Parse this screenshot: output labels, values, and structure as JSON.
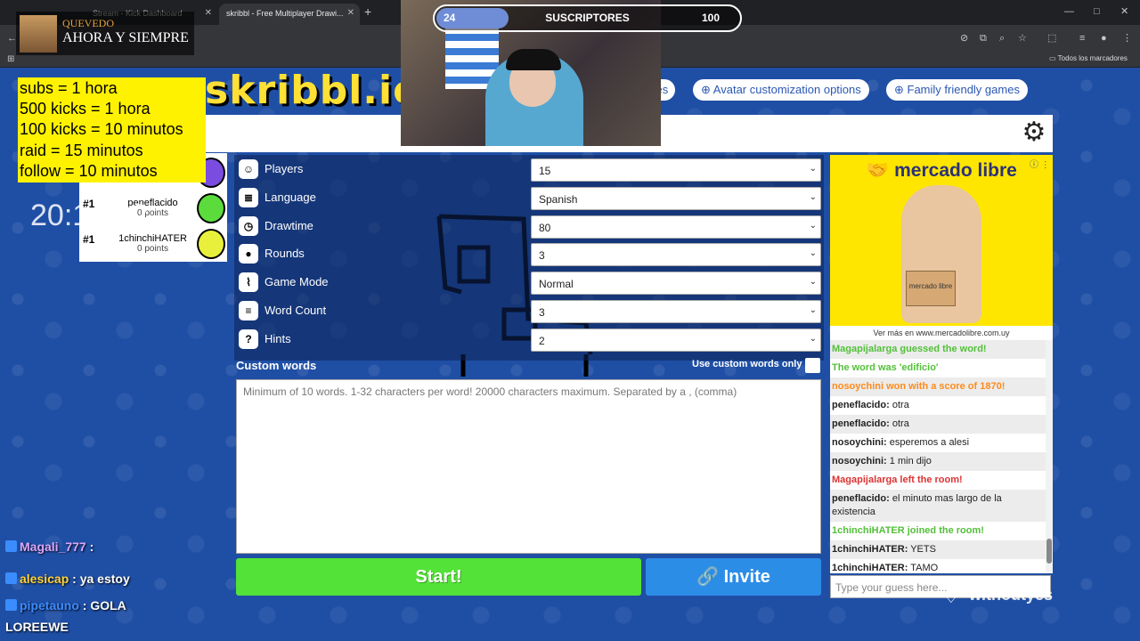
{
  "browser": {
    "tabs": [
      {
        "label": "Stream - Kick Dashboard"
      },
      {
        "label": "skribbl - Free Multiplayer Drawi..."
      }
    ],
    "new_tab_label": "+",
    "bookmarks_label": "Todos los marcadores"
  },
  "song": {
    "artist": "QUEVEDO",
    "title": "AHORA Y SIEMPRE"
  },
  "subs_goal": {
    "current": "24",
    "label": "SUSCRIPTORES",
    "goal": "100",
    "fraction": 0.24
  },
  "subs_rules": [
    "subs = 1 hora",
    "500 kicks = 1 hora",
    "100 kicks = 10 minutos",
    "raid = 15 minutos",
    "follow = 10 minutos"
  ],
  "clock": "20:14:32",
  "header_links": [
    "Avatar customization options",
    "Family friendly games"
  ],
  "header_link_partial": "ses",
  "players": [
    {
      "rank": "#1",
      "name": "peneflacido",
      "points": "0 points",
      "color": "#5bdc3c"
    },
    {
      "rank": "#1",
      "name": "1chinchiHATER",
      "points": "0 points",
      "color": "#e9f03c"
    }
  ],
  "settings": [
    {
      "label": "Players",
      "value": "15",
      "icon": "person-icon"
    },
    {
      "label": "Language",
      "value": "Spanish",
      "icon": "language-icon"
    },
    {
      "label": "Drawtime",
      "value": "80",
      "icon": "clock-icon"
    },
    {
      "label": "Rounds",
      "value": "3",
      "icon": "rounds-icon"
    },
    {
      "label": "Game Mode",
      "value": "Normal",
      "icon": "gamemode-icon"
    },
    {
      "label": "Word Count",
      "value": "3",
      "icon": "wordcount-icon"
    },
    {
      "label": "Hints",
      "value": "2",
      "icon": "question-icon"
    }
  ],
  "custom_words": {
    "label": "Custom words",
    "toggle_label": "Use custom words only",
    "placeholder": "Minimum of 10 words. 1-32 characters per word! 20000 characters maximum. Separated by a , (comma)"
  },
  "buttons": {
    "start": "Start!",
    "invite": "Invite"
  },
  "ad": {
    "brand": "mercado libre",
    "box_text": "mercado libre",
    "url": "Ver más en www.mercadolibre.com.uy"
  },
  "chat": [
    {
      "type": "green",
      "text": "Magapijalarga guessed the word!"
    },
    {
      "type": "green",
      "text": "The word was 'edificio'"
    },
    {
      "type": "orange",
      "text": "nosoychini won with a score of 1870!"
    },
    {
      "type": "msg",
      "user": "peneflacido:",
      "text": "otra"
    },
    {
      "type": "msg",
      "user": "peneflacido:",
      "text": "otra"
    },
    {
      "type": "msg",
      "user": "nosoychini:",
      "text": "esperemos a alesi"
    },
    {
      "type": "msg",
      "user": "nosoychini:",
      "text": "1 min dijo"
    },
    {
      "type": "red",
      "text": "Magapijalarga left the room!"
    },
    {
      "type": "msg",
      "user": "peneflacido:",
      "text": "el minuto mas largo de la existencia"
    },
    {
      "type": "green",
      "text": "1chinchiHATER joined the room!"
    },
    {
      "type": "msg",
      "user": "1chinchiHATER:",
      "text": "YETS"
    },
    {
      "type": "msg",
      "user": "1chinchiHATER:",
      "text": "TAMO"
    }
  ],
  "guess_placeholder": "Type your guess here...",
  "stream_chat": [
    {
      "user": "Magali_777",
      "sep": " :",
      "text": "",
      "color": "#d9a6ff"
    },
    {
      "user": "alesicap",
      "sep": " :",
      "text": " ya estoy",
      "color": "#ffd23c"
    },
    {
      "user": "pipetauno",
      "sep": " :",
      "text": " GOLA",
      "color": "#3c8cff"
    },
    {
      "user": "",
      "sep": "",
      "text": "LOREEWE",
      "color": "#fff"
    }
  ],
  "watermark": "withoutyes",
  "colors": {
    "start": "#53e237",
    "invite": "#2c8de7",
    "bg": "#1f4fa5",
    "logo": "#ffe035"
  }
}
